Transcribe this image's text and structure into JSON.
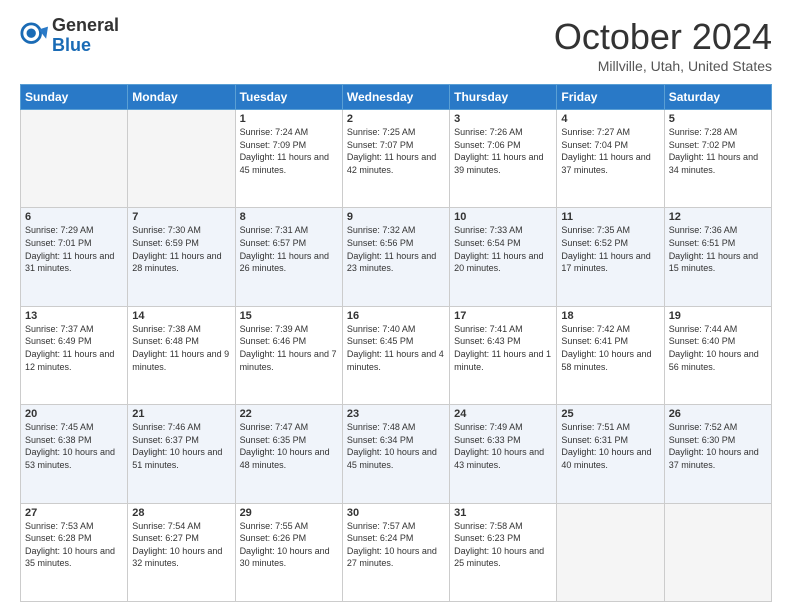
{
  "header": {
    "logo_general": "General",
    "logo_blue": "Blue",
    "month_title": "October 2024",
    "location": "Millville, Utah, United States"
  },
  "days_of_week": [
    "Sunday",
    "Monday",
    "Tuesday",
    "Wednesday",
    "Thursday",
    "Friday",
    "Saturday"
  ],
  "weeks": [
    [
      {
        "day": "",
        "empty": true
      },
      {
        "day": "",
        "empty": true
      },
      {
        "day": "1",
        "sunrise": "7:24 AM",
        "sunset": "7:09 PM",
        "daylight": "11 hours and 45 minutes."
      },
      {
        "day": "2",
        "sunrise": "7:25 AM",
        "sunset": "7:07 PM",
        "daylight": "11 hours and 42 minutes."
      },
      {
        "day": "3",
        "sunrise": "7:26 AM",
        "sunset": "7:06 PM",
        "daylight": "11 hours and 39 minutes."
      },
      {
        "day": "4",
        "sunrise": "7:27 AM",
        "sunset": "7:04 PM",
        "daylight": "11 hours and 37 minutes."
      },
      {
        "day": "5",
        "sunrise": "7:28 AM",
        "sunset": "7:02 PM",
        "daylight": "11 hours and 34 minutes."
      }
    ],
    [
      {
        "day": "6",
        "sunrise": "7:29 AM",
        "sunset": "7:01 PM",
        "daylight": "11 hours and 31 minutes."
      },
      {
        "day": "7",
        "sunrise": "7:30 AM",
        "sunset": "6:59 PM",
        "daylight": "11 hours and 28 minutes."
      },
      {
        "day": "8",
        "sunrise": "7:31 AM",
        "sunset": "6:57 PM",
        "daylight": "11 hours and 26 minutes."
      },
      {
        "day": "9",
        "sunrise": "7:32 AM",
        "sunset": "6:56 PM",
        "daylight": "11 hours and 23 minutes."
      },
      {
        "day": "10",
        "sunrise": "7:33 AM",
        "sunset": "6:54 PM",
        "daylight": "11 hours and 20 minutes."
      },
      {
        "day": "11",
        "sunrise": "7:35 AM",
        "sunset": "6:52 PM",
        "daylight": "11 hours and 17 minutes."
      },
      {
        "day": "12",
        "sunrise": "7:36 AM",
        "sunset": "6:51 PM",
        "daylight": "11 hours and 15 minutes."
      }
    ],
    [
      {
        "day": "13",
        "sunrise": "7:37 AM",
        "sunset": "6:49 PM",
        "daylight": "11 hours and 12 minutes."
      },
      {
        "day": "14",
        "sunrise": "7:38 AM",
        "sunset": "6:48 PM",
        "daylight": "11 hours and 9 minutes."
      },
      {
        "day": "15",
        "sunrise": "7:39 AM",
        "sunset": "6:46 PM",
        "daylight": "11 hours and 7 minutes."
      },
      {
        "day": "16",
        "sunrise": "7:40 AM",
        "sunset": "6:45 PM",
        "daylight": "11 hours and 4 minutes."
      },
      {
        "day": "17",
        "sunrise": "7:41 AM",
        "sunset": "6:43 PM",
        "daylight": "11 hours and 1 minute."
      },
      {
        "day": "18",
        "sunrise": "7:42 AM",
        "sunset": "6:41 PM",
        "daylight": "10 hours and 58 minutes."
      },
      {
        "day": "19",
        "sunrise": "7:44 AM",
        "sunset": "6:40 PM",
        "daylight": "10 hours and 56 minutes."
      }
    ],
    [
      {
        "day": "20",
        "sunrise": "7:45 AM",
        "sunset": "6:38 PM",
        "daylight": "10 hours and 53 minutes."
      },
      {
        "day": "21",
        "sunrise": "7:46 AM",
        "sunset": "6:37 PM",
        "daylight": "10 hours and 51 minutes."
      },
      {
        "day": "22",
        "sunrise": "7:47 AM",
        "sunset": "6:35 PM",
        "daylight": "10 hours and 48 minutes."
      },
      {
        "day": "23",
        "sunrise": "7:48 AM",
        "sunset": "6:34 PM",
        "daylight": "10 hours and 45 minutes."
      },
      {
        "day": "24",
        "sunrise": "7:49 AM",
        "sunset": "6:33 PM",
        "daylight": "10 hours and 43 minutes."
      },
      {
        "day": "25",
        "sunrise": "7:51 AM",
        "sunset": "6:31 PM",
        "daylight": "10 hours and 40 minutes."
      },
      {
        "day": "26",
        "sunrise": "7:52 AM",
        "sunset": "6:30 PM",
        "daylight": "10 hours and 37 minutes."
      }
    ],
    [
      {
        "day": "27",
        "sunrise": "7:53 AM",
        "sunset": "6:28 PM",
        "daylight": "10 hours and 35 minutes."
      },
      {
        "day": "28",
        "sunrise": "7:54 AM",
        "sunset": "6:27 PM",
        "daylight": "10 hours and 32 minutes."
      },
      {
        "day": "29",
        "sunrise": "7:55 AM",
        "sunset": "6:26 PM",
        "daylight": "10 hours and 30 minutes."
      },
      {
        "day": "30",
        "sunrise": "7:57 AM",
        "sunset": "6:24 PM",
        "daylight": "10 hours and 27 minutes."
      },
      {
        "day": "31",
        "sunrise": "7:58 AM",
        "sunset": "6:23 PM",
        "daylight": "10 hours and 25 minutes."
      },
      {
        "day": "",
        "empty": true
      },
      {
        "day": "",
        "empty": true
      }
    ]
  ],
  "labels": {
    "sunrise": "Sunrise:",
    "sunset": "Sunset:",
    "daylight": "Daylight:"
  }
}
